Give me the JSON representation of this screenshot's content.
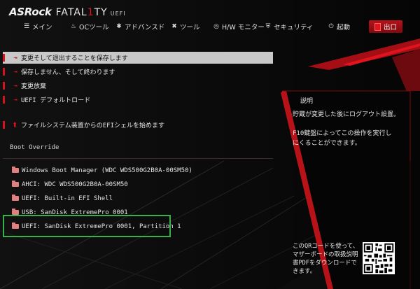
{
  "brand": {
    "name": "ASRock",
    "series": "FATAL",
    "series_mark": "1",
    "series_end": "TY",
    "uefi": "UEFI"
  },
  "nav": [
    {
      "label": "メイン",
      "icon": "list-icon"
    },
    {
      "label": "OCツール",
      "icon": "flame-icon"
    },
    {
      "label": "アドバンスド",
      "icon": "star-icon"
    },
    {
      "label": "ツール",
      "icon": "tools-icon"
    },
    {
      "label": "H/W モニター",
      "icon": "monitor-icon"
    },
    {
      "label": "セキュリティ",
      "icon": "shield-icon"
    },
    {
      "label": "起動",
      "icon": "power-icon"
    },
    {
      "label": "出口",
      "icon": "exit-icon"
    }
  ],
  "exit_items": [
    {
      "label": "変更そして退出することを保存します",
      "selected": true
    },
    {
      "label": "保存しません、そして終わります",
      "selected": false
    },
    {
      "label": "変更放棄",
      "selected": false
    },
    {
      "label": "UEFI デフォルトロード",
      "selected": false
    },
    {
      "label": "ファイルシステム装置からのEFIシェルを始めます",
      "selected": false
    }
  ],
  "boot_override": {
    "title": "Boot Override",
    "items": [
      {
        "label": "Windows Boot Manager (WDC WDS500G2B0A-00SM50)"
      },
      {
        "label": "AHCI:  WDC WDS500G2B0A-00SM50"
      },
      {
        "label": "UEFI: Built-in EFI Shell"
      },
      {
        "label": "USB: SanDisk ExtremePro 0001"
      },
      {
        "label": "UEFI: SanDisk ExtremePro 0001, Partition 1"
      }
    ]
  },
  "description": {
    "title": "説明",
    "text1": "貯蔵が変更した後にログアウト設置。",
    "text2": "F10鍵盤によってこの操作を実行し\nにくることができます。"
  },
  "qr_note": "このQRコードを使って、マザーボードの取扱説明書PDFをダウンロードできます。",
  "colors": {
    "accent": "#e1141e",
    "selection": "#c8c8c8",
    "highlight": "#38b14c"
  }
}
